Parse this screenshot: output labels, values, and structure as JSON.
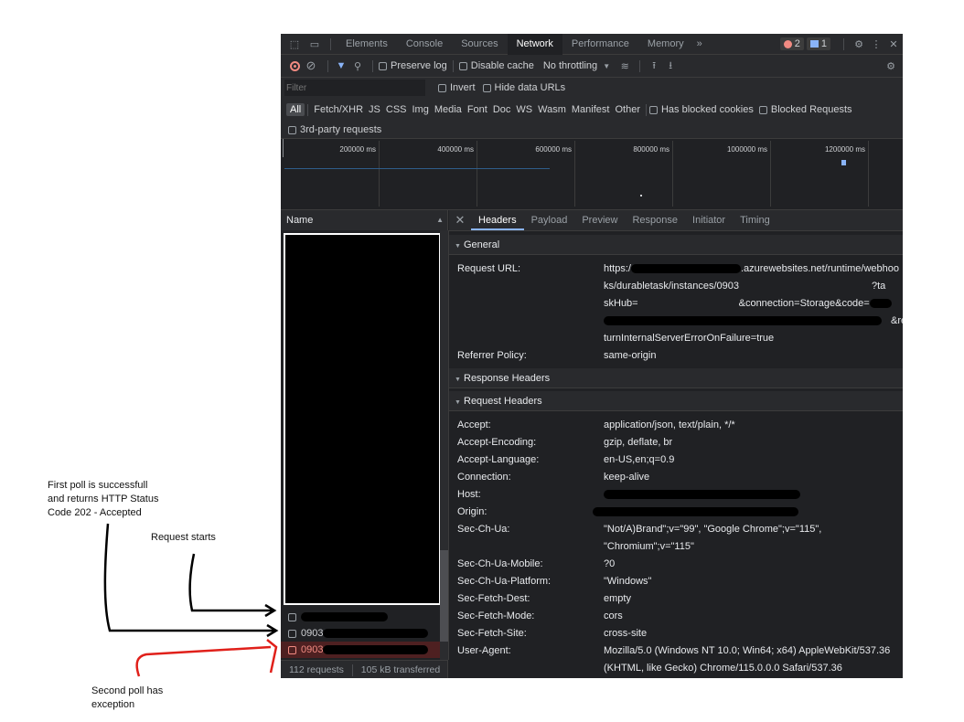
{
  "tabs": [
    "Elements",
    "Console",
    "Sources",
    "Network",
    "Performance",
    "Memory"
  ],
  "more_tabs": "»",
  "error_count": "2",
  "message_count": "1",
  "toolbar": {
    "preserve_log": "Preserve log",
    "disable_cache": "Disable cache",
    "throttling": "No throttling"
  },
  "filter": {
    "placeholder": "Filter",
    "invert": "Invert",
    "hide_data_urls": "Hide data URLs"
  },
  "types": [
    "All",
    "Fetch/XHR",
    "JS",
    "CSS",
    "Img",
    "Media",
    "Font",
    "Doc",
    "WS",
    "Wasm",
    "Manifest",
    "Other"
  ],
  "has_blocked_cookies": "Has blocked cookies",
  "blocked_requests": "Blocked Requests",
  "third_party": "3rd-party requests",
  "timeline_ticks": [
    "200000 ms",
    "400000 ms",
    "600000 ms",
    "800000 ms",
    "1000000 ms",
    "1200000 ms"
  ],
  "name_header": "Name",
  "requests": [
    {
      "label": "",
      "error": false
    },
    {
      "label": "0903",
      "error": false
    },
    {
      "label": "0903",
      "error": true
    }
  ],
  "status": {
    "requests": "112 requests",
    "transferred": "105 kB transferred"
  },
  "detail_tabs": [
    "Headers",
    "Payload",
    "Preview",
    "Response",
    "Initiator",
    "Timing"
  ],
  "general": {
    "title": "General",
    "request_url_key": "Request URL:",
    "url_lines": [
      "https:/",
      "ks/durabletask/instances/0903",
      "skHub=",
      "",
      "turnInternalServerErrorOnFailure=true"
    ],
    "url_frags": [
      ".azurewebsites.net/runtime/webhoo",
      "?ta",
      "&connection=Storage&code=",
      "&re"
    ],
    "referrer_key": "Referrer Policy:",
    "referrer_val": "same-origin"
  },
  "response_headers_title": "Response Headers",
  "request_headers": {
    "title": "Request Headers",
    "items": [
      {
        "k": "Accept:",
        "v": "application/json, text/plain, */*"
      },
      {
        "k": "Accept-Encoding:",
        "v": "gzip, deflate, br"
      },
      {
        "k": "Accept-Language:",
        "v": "en-US,en;q=0.9"
      },
      {
        "k": "Connection:",
        "v": "keep-alive"
      },
      {
        "k": "Host:",
        "v": ""
      },
      {
        "k": "Origin:",
        "v": ""
      },
      {
        "k": "Sec-Ch-Ua:",
        "v": "\"Not/A)Brand\";v=\"99\", \"Google Chrome\";v=\"115\",",
        "v2": "\"Chromium\";v=\"115\""
      },
      {
        "k": "Sec-Ch-Ua-Mobile:",
        "v": "?0"
      },
      {
        "k": "Sec-Ch-Ua-Platform:",
        "v": "\"Windows\""
      },
      {
        "k": "Sec-Fetch-Dest:",
        "v": "empty"
      },
      {
        "k": "Sec-Fetch-Mode:",
        "v": "cors"
      },
      {
        "k": "Sec-Fetch-Site:",
        "v": "cross-site"
      },
      {
        "k": "User-Agent:",
        "v": "Mozilla/5.0 (Windows NT 10.0; Win64; x64) AppleWebKit/537.36",
        "v2": "(KHTML, like Gecko) Chrome/115.0.0.0 Safari/537.36"
      }
    ]
  },
  "annotations": {
    "first_poll": [
      "First poll is successfull",
      "and returns HTTP Status",
      "Code 202 - Accepted"
    ],
    "request_starts": "Request starts",
    "second_poll": [
      "Second poll has",
      "exception"
    ]
  },
  "colors": {
    "accent": "#8ab4f8",
    "record": "#f28b82",
    "error_row": "#4e2021",
    "annotation_red": "#e0201a"
  }
}
